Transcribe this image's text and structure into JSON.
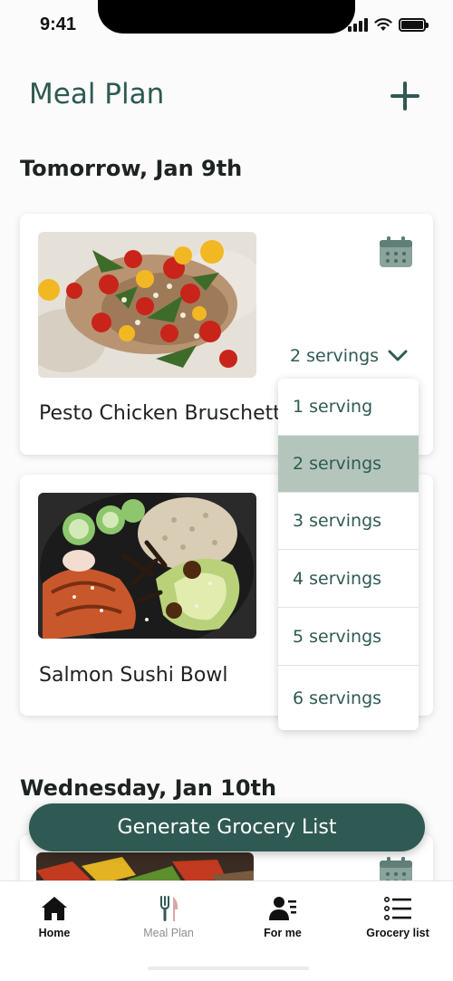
{
  "status_bar": {
    "time": "9:41"
  },
  "header": {
    "title": "Meal Plan",
    "add_icon": "plus-icon"
  },
  "days": [
    {
      "heading": "Tomorrow, Jan 9th",
      "meals": [
        {
          "name": "Pesto Chicken Bruschetta",
          "servings": "2 servings",
          "photo": "bruschetta-photo"
        },
        {
          "name": "Salmon Sushi Bowl",
          "photo": "salmon-bowl-photo"
        }
      ]
    },
    {
      "heading": "Wednesday, Jan 10th",
      "meals": [
        {
          "photo": "stir-fry-photo"
        }
      ]
    }
  ],
  "servings_dropdown": {
    "options": [
      "1 serving",
      "2 servings",
      "3 servings",
      "4 servings",
      "5 servings",
      "6 servings"
    ],
    "selected": "2 servings"
  },
  "generate_button": {
    "label": "Generate Grocery List"
  },
  "tab_bar": {
    "active": "Meal Plan",
    "tabs": [
      {
        "label": "Home",
        "icon": "home-icon"
      },
      {
        "label": "Meal Plan",
        "icon": "fork-knife-icon"
      },
      {
        "label": "For me",
        "icon": "profile-list-icon"
      },
      {
        "label": "Grocery list",
        "icon": "checklist-icon"
      }
    ]
  },
  "colors": {
    "primary": "#2f5a53",
    "selected_option": "#b4c6bc",
    "calendar_icon": "#8aa39c",
    "background": "#fafbfa"
  }
}
